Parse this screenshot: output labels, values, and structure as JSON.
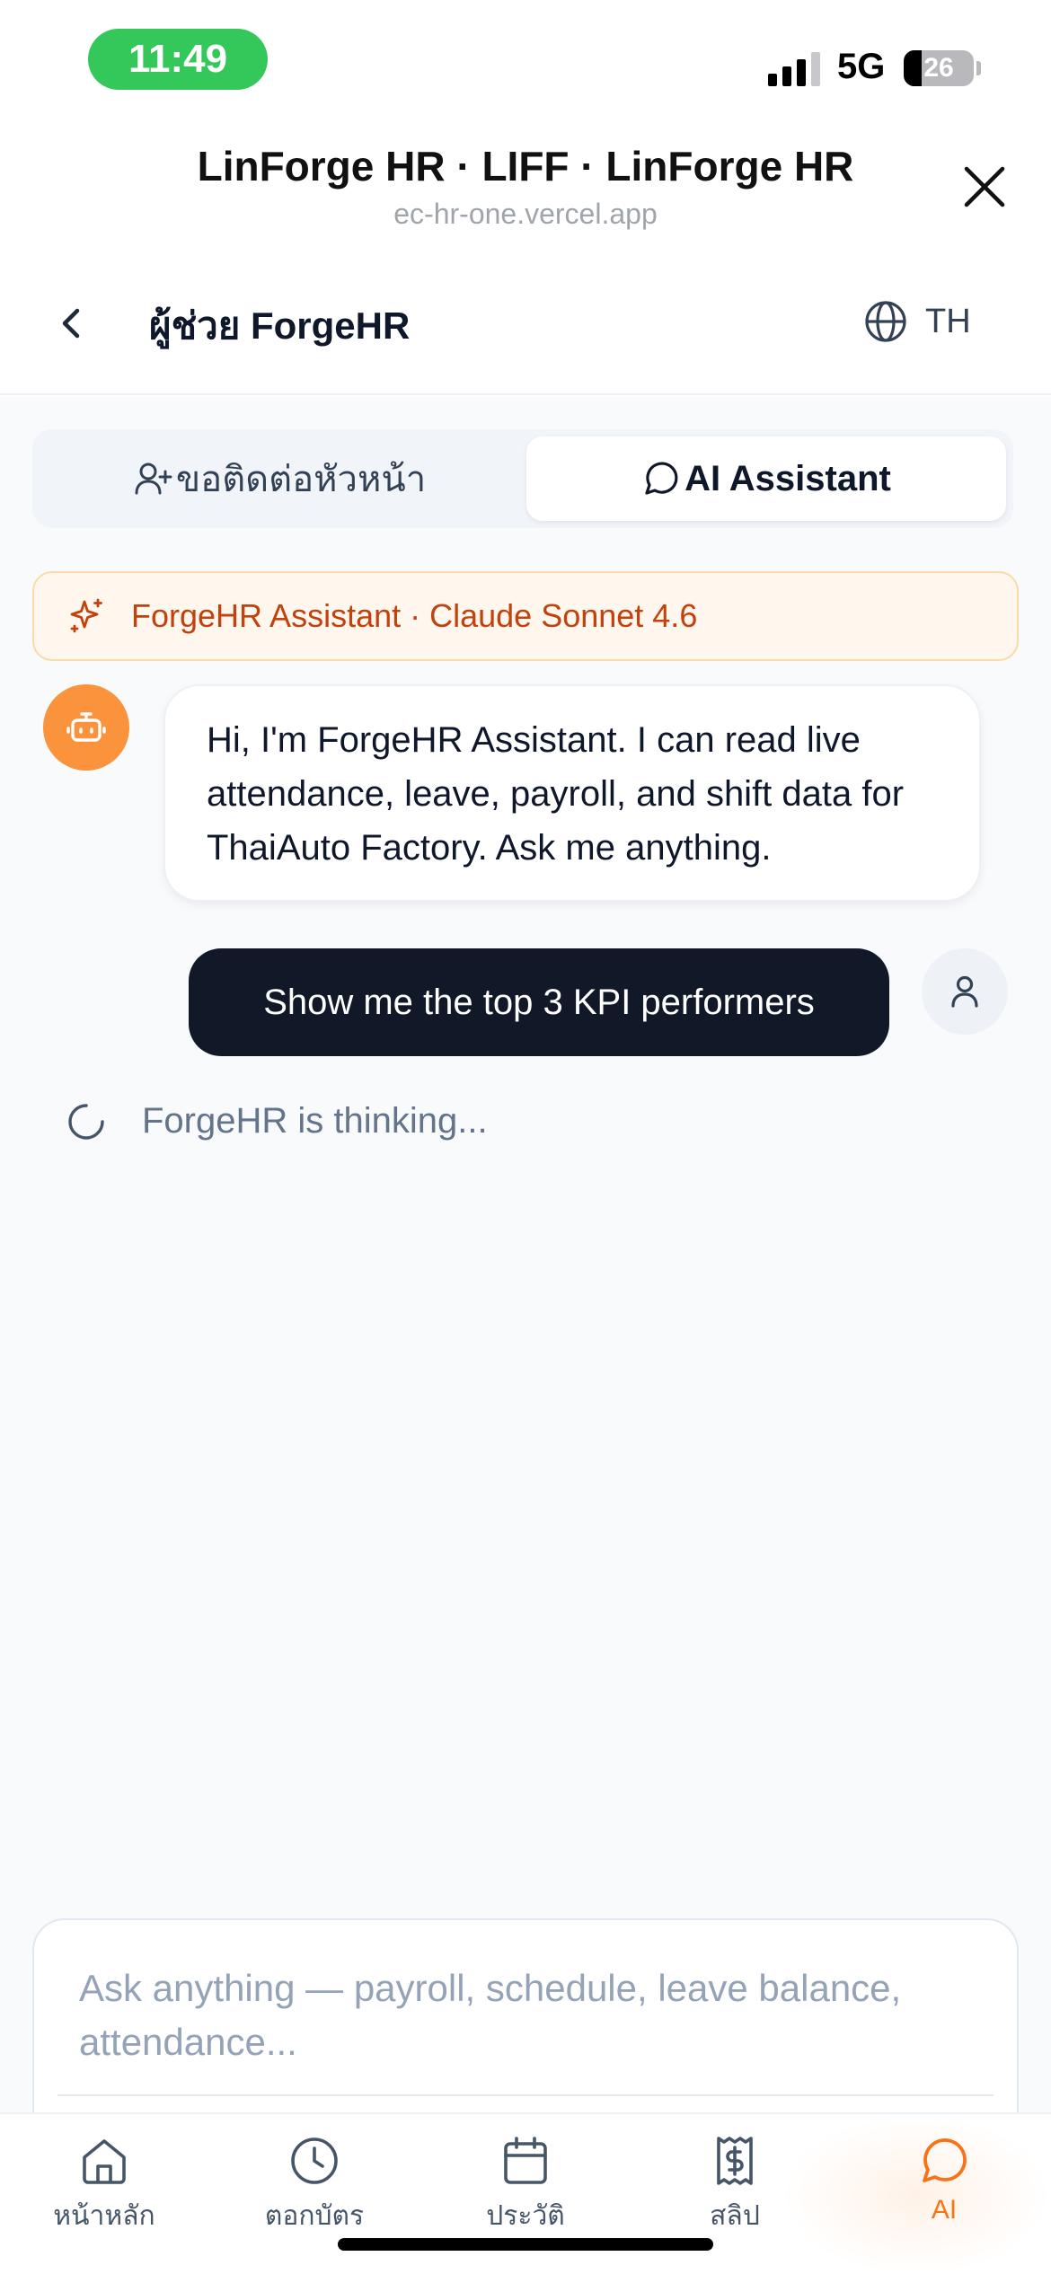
{
  "status_bar": {
    "time": "11:49",
    "network": "5G",
    "battery": "26",
    "battery_level_percent": 26
  },
  "liff": {
    "title": "LinForge HR · LIFF · LinForge HR",
    "url": "ec-hr-one.vercel.app"
  },
  "header": {
    "title": "ผู้ช่วย ForgeHR",
    "language": "TH"
  },
  "tabs": [
    {
      "label": "ขอติดต่อหัวหน้า",
      "icon": "user-plus-icon",
      "active": false
    },
    {
      "label": "AI Assistant",
      "icon": "message-circle-icon",
      "active": true
    }
  ],
  "model_banner": {
    "text": "ForgeHR Assistant · Claude Sonnet 4.6",
    "icon": "sparkles-icon"
  },
  "messages": [
    {
      "role": "assistant",
      "text": "Hi, I'm ForgeHR Assistant. I can read live attendance, leave, payroll, and shift data for ThaiAuto Factory. Ask me anything."
    },
    {
      "role": "user",
      "text": "Show me the top 3 KPI performers"
    }
  ],
  "thinking": "ForgeHR is thinking...",
  "composer": {
    "placeholder": "Ask anything — payroll, schedule, leave balance, attendance..."
  },
  "bottom_nav": [
    {
      "label": "หน้าหลัก",
      "icon": "home-icon",
      "active": false
    },
    {
      "label": "ตอกบัตร",
      "icon": "clock-icon",
      "active": false
    },
    {
      "label": "ประวัติ",
      "icon": "calendar-icon",
      "active": false
    },
    {
      "label": "สลิป",
      "icon": "receipt-icon",
      "active": false
    },
    {
      "label": "AI",
      "icon": "message-circle-icon",
      "active": true
    }
  ],
  "colors": {
    "accent": "#f97316",
    "status_pill": "#34c759",
    "user_bubble": "#111827",
    "banner_bg": "#fff7ed"
  }
}
